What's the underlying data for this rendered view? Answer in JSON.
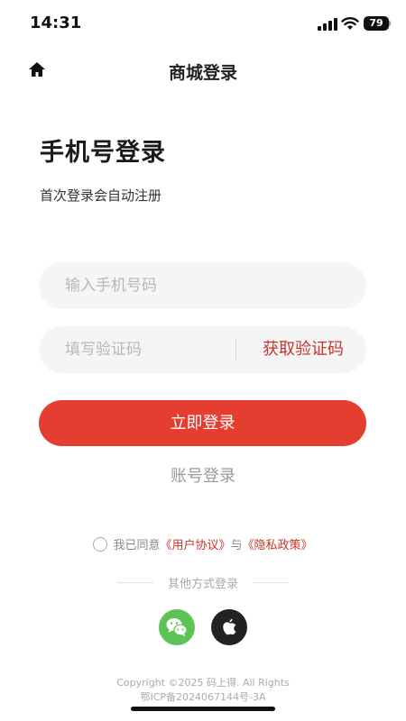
{
  "status_bar": {
    "time": "14:31",
    "battery": "79"
  },
  "nav": {
    "title": "商城登录",
    "home_icon": "home-icon"
  },
  "header": {
    "title": "手机号登录",
    "subtitle": "首次登录会自动注册"
  },
  "form": {
    "phone_placeholder": "输入手机号码",
    "phone_value": "",
    "code_placeholder": "填写验证码",
    "code_value": "",
    "get_code_label": "获取验证码",
    "login_label": "立即登录",
    "account_login_label": "账号登录"
  },
  "agreement": {
    "prefix": "我已同意",
    "user_agreement": "《用户协议》",
    "connector": "与",
    "privacy_policy": "《隐私政策》"
  },
  "other_login": {
    "label": "其他方式登录",
    "methods": [
      "wechat-icon",
      "apple-icon"
    ]
  },
  "footer": {
    "copyright": "Copyright ©2025 码上得. All Rights",
    "icp": "鄂ICP备2024067144号-3A"
  },
  "colors": {
    "accent": "#e53e30",
    "link": "#c8352a",
    "wechat": "#5ec356"
  }
}
